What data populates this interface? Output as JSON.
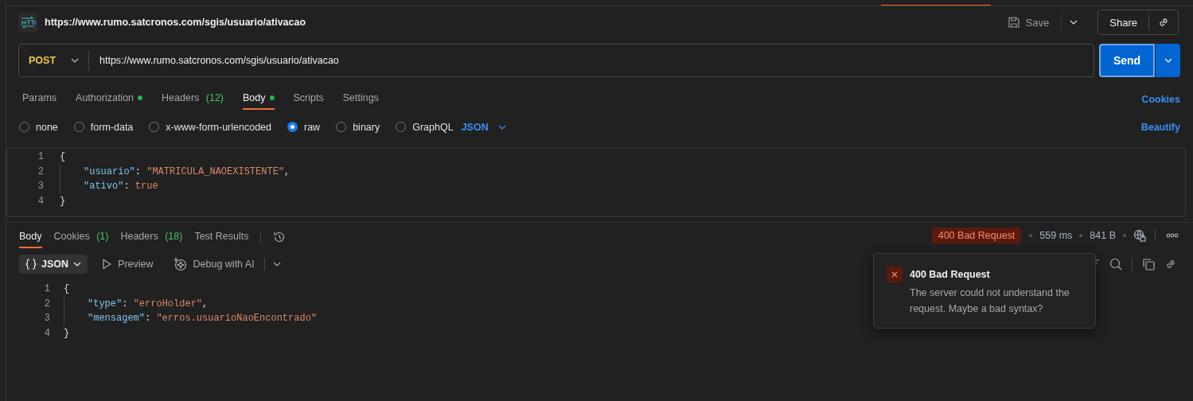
{
  "request": {
    "title": "https://www.rumo.satcronos.com/sgis/usuario/ativacao",
    "save": "Save",
    "share": "Share",
    "method": "POST",
    "url": "https://www.rumo.satcronos.com/sgis/usuario/ativacao",
    "send": "Send"
  },
  "request_tabs": [
    {
      "label": "Params",
      "selected": false
    },
    {
      "label": "Authorization",
      "selected": false,
      "dot": true
    },
    {
      "label": "Headers",
      "count": "(12)",
      "selected": false
    },
    {
      "label": "Body",
      "selected": true,
      "dot": true
    },
    {
      "label": "Scripts",
      "selected": false
    },
    {
      "label": "Settings",
      "selected": false
    }
  ],
  "cookies_link": "Cookies",
  "body_types": [
    {
      "label": "none",
      "selected": false
    },
    {
      "label": "form-data",
      "selected": false
    },
    {
      "label": "x-www-form-urlencoded",
      "selected": false
    },
    {
      "label": "raw",
      "selected": true
    },
    {
      "label": "binary",
      "selected": false
    },
    {
      "label": "GraphQL",
      "selected": false
    }
  ],
  "body_format": "JSON",
  "beautify": "Beautify",
  "request_body": [
    {
      "number": "1",
      "indented": false,
      "tokens": [
        {
          "kind": "punct",
          "text": "{"
        }
      ]
    },
    {
      "number": "2",
      "indented": true,
      "tokens": [
        {
          "kind": "key",
          "text": "\"usuario\""
        },
        {
          "kind": "punct",
          "text": ": "
        },
        {
          "kind": "string",
          "text": "\"MATRICULA_NAOEXISTENTE\""
        },
        {
          "kind": "punct",
          "text": ","
        }
      ]
    },
    {
      "number": "3",
      "indented": true,
      "tokens": [
        {
          "kind": "key",
          "text": "\"ativo\""
        },
        {
          "kind": "punct",
          "text": ": "
        },
        {
          "kind": "literal",
          "text": "true"
        }
      ]
    },
    {
      "number": "4",
      "indented": false,
      "tokens": [
        {
          "kind": "punct",
          "text": "}"
        }
      ]
    }
  ],
  "response_tabs": [
    {
      "label": "Body",
      "selected": true
    },
    {
      "label": "Cookies",
      "count": "(1)",
      "selected": false
    },
    {
      "label": "Headers",
      "count": "(18)",
      "selected": false
    },
    {
      "label": "Test Results",
      "selected": false
    }
  ],
  "response_status": {
    "status": "400 Bad Request",
    "time": "559 ms",
    "size": "841 B"
  },
  "response_toolbar": {
    "format": "JSON",
    "preview": "Preview",
    "debug": "Debug with AI"
  },
  "response_body": [
    {
      "number": "1",
      "indented": false,
      "tokens": [
        {
          "kind": "punct",
          "text": "{"
        }
      ]
    },
    {
      "number": "2",
      "indented": true,
      "tokens": [
        {
          "kind": "key",
          "text": "\"type\""
        },
        {
          "kind": "punct",
          "text": ": "
        },
        {
          "kind": "string",
          "text": "\"erroHolder\""
        },
        {
          "kind": "punct",
          "text": ","
        }
      ]
    },
    {
      "number": "3",
      "indented": true,
      "tokens": [
        {
          "kind": "key",
          "text": "\"mensagem\""
        },
        {
          "kind": "punct",
          "text": ": "
        },
        {
          "kind": "string",
          "text": "\"erros.usuarioNaoEncontrado\""
        }
      ]
    },
    {
      "number": "4",
      "indented": false,
      "tokens": [
        {
          "kind": "punct",
          "text": "}"
        }
      ]
    }
  ],
  "toast": {
    "title": "400 Bad Request",
    "message": "The server could not understand the request. Maybe a bad syntax?"
  }
}
